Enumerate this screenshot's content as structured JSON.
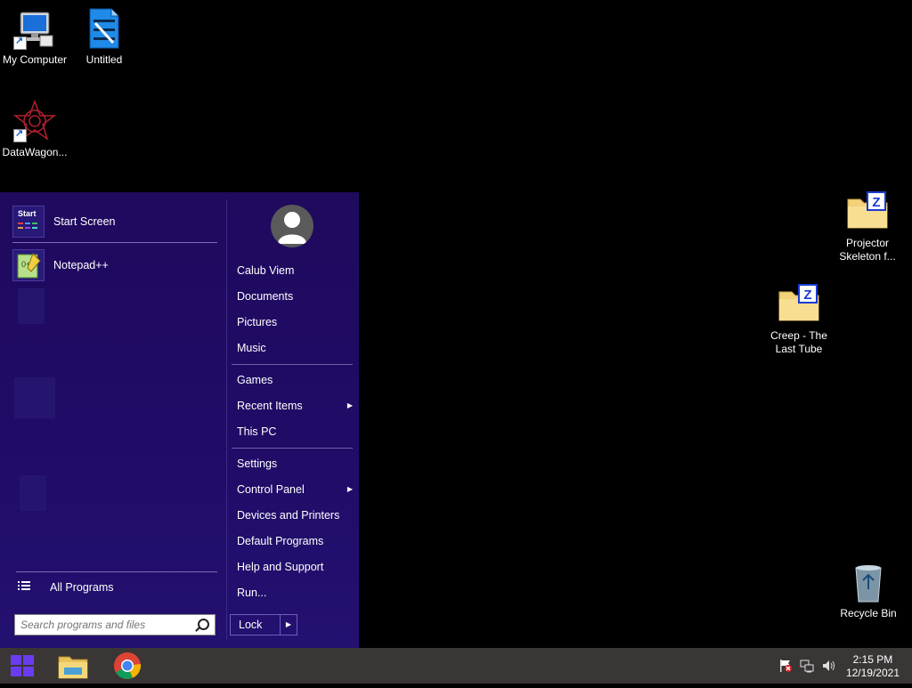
{
  "desktop": {
    "icons": [
      {
        "label": "My Computer",
        "icon": "my-computer-icon"
      },
      {
        "label": "Untitled",
        "icon": "video-file-icon"
      },
      {
        "label": "DataWagon...",
        "icon": "datawagon-icon"
      },
      {
        "label": "Projector\nSkeleton f...",
        "icon": "zip-folder-icon"
      },
      {
        "label": "Creep - The\nLast Tube",
        "icon": "zip-folder-icon"
      },
      {
        "label": "Recycle Bin",
        "icon": "recycle-bin-icon"
      }
    ]
  },
  "start_menu": {
    "pinned": [
      {
        "label": "Start Screen",
        "icon": "start-screen-icon",
        "tile_text": "Start"
      },
      {
        "label": "Notepad++",
        "icon": "notepad-plus-plus-icon"
      }
    ],
    "all_programs": "All Programs",
    "search_placeholder": "Search programs and files",
    "user_name": "Calub Viem",
    "right_items": [
      {
        "label": "Documents"
      },
      {
        "label": "Pictures"
      },
      {
        "label": "Music"
      },
      {
        "label": "Games"
      },
      {
        "label": "Recent Items",
        "submenu": true
      },
      {
        "label": "This PC"
      },
      {
        "label": "Settings"
      },
      {
        "label": "Control Panel",
        "submenu": true
      },
      {
        "label": "Devices and Printers"
      },
      {
        "label": "Default Programs"
      },
      {
        "label": "Help and Support"
      },
      {
        "label": "Run..."
      }
    ],
    "lock_label": "Lock"
  },
  "taskbar": {
    "time": "2:15 PM",
    "date": "12/19/2021",
    "pinned": [
      "file-explorer-icon",
      "chrome-icon"
    ],
    "tray": [
      "action-center-flag-icon",
      "network-icon",
      "volume-icon"
    ]
  },
  "colors": {
    "start_menu_bg": "#200b66",
    "taskbar_bg": "#3a3636",
    "windows_logo": "#6a3cf0"
  }
}
